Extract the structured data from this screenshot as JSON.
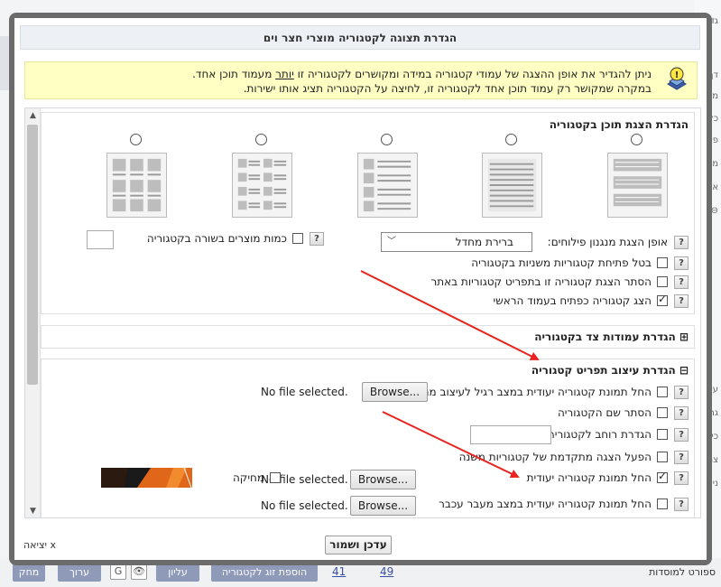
{
  "background": {
    "right_items": [
      "גדר",
      "דף",
      "מו",
      "כל",
      "פי",
      "מוג",
      "סו",
      "אב",
      "⊖"
    ],
    "right_lower_items": [
      "עיי",
      "גר",
      "כי",
      "צנ",
      "ניי",
      "או",
      "רי"
    ],
    "bottom_buttons": [
      "מחק",
      "ערוך",
      "עליון",
      "הוספת זוג לקטגוריה"
    ],
    "bottom_links": [
      "41",
      "49"
    ],
    "bottom_text": "ספורט למוסדות"
  },
  "modal": {
    "title": "הגדרת תצוגה לקטגוריה מוצרי חצר וים",
    "note_line1_a": "ניתן להגדיר את אופן ההצגה של עמודי קטגוריה במידה ומקושרים לקטגוריה זו ",
    "note_line1_u": "יותר",
    "note_line1_b": " מעמוד תוכן אחד.",
    "note_line2": "במקרה שמקושר רק עמוד תוכן אחד לקטגוריה זו, לחיצה על הקטגוריה תציג אותו ישירות.",
    "save_button": "עדכן ושמור",
    "exit_link": "x יציאה"
  },
  "display_section": {
    "title": "הגדרת הצגת תוכן בקטגוריה",
    "filter_label": "אופן הצגת מנגנון פילוחים:",
    "filter_value": "ברירת מחדל",
    "products_per_row_label": "כמות מוצרים בשורה בקטגוריה",
    "options": [
      {
        "label": "בטל פתיחת קטגוריות משניות בקטגוריה",
        "checked": false
      },
      {
        "label": "הסתר הצגת קטגוריה זו בתפריט קטגוריות באתר",
        "checked": false
      },
      {
        "label": "הצג קטגוריה כפתיח בעמוד הראשי",
        "checked": true
      }
    ],
    "help": "?"
  },
  "side_columns_section": {
    "title": "הגדרת עמודות צד בקטגוריה",
    "toggle": "⊞"
  },
  "menu_design_section": {
    "title": "הגדרת עיצוב תפריט קטגוריה",
    "toggle": "⊟",
    "rows": [
      {
        "label": "החל תמונת קטגוריה יעודית במצב רגיל לעיצוב מתקדם",
        "checked": false
      },
      {
        "label": "הסתר שם הקטגוריה",
        "checked": false
      },
      {
        "label": "הגדרת רוחב לקטגוריה:",
        "checked": false
      },
      {
        "label": "הפעל הצגה מתקדמת של קטגוריות משנה",
        "checked": false
      },
      {
        "label": "החל תמונת קטגוריה יעודית",
        "checked": true
      },
      {
        "label": "החל תמונת קטגוריה יעודית במצב מעבר עכבר",
        "checked": false
      }
    ],
    "browse_label": "Browse...",
    "no_file": "No file selected.",
    "delete_label": "מחיקה"
  },
  "colors": {
    "arrow": "#e8231f",
    "note_bg": "#ffffc4",
    "frame": "#6b6b6b"
  }
}
